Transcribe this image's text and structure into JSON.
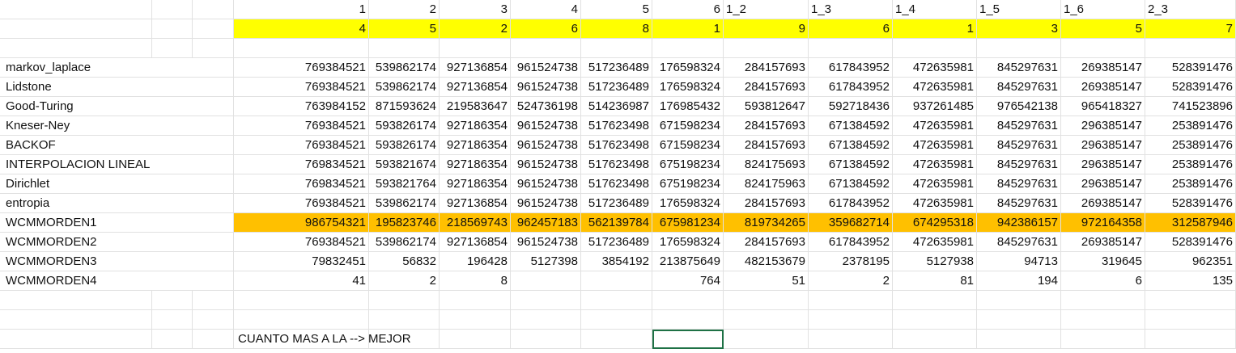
{
  "headers": [
    "1",
    "2",
    "3",
    "4",
    "5",
    "6",
    "1_2",
    "1_3",
    "1_4",
    "1_5",
    "1_6",
    "2_3"
  ],
  "ranks": [
    "4",
    "5",
    "2",
    "6",
    "8",
    "1",
    "9",
    "6",
    "1",
    "3",
    "5",
    "7"
  ],
  "rows": [
    {
      "label": "markov_laplace",
      "values": [
        "769384521",
        "539862174",
        "927136854",
        "961524738",
        "517236489",
        "176598324",
        "284157693",
        "617843952",
        "472635981",
        "845297631",
        "269385147",
        "528391476"
      ]
    },
    {
      "label": "Lidstone",
      "values": [
        "769384521",
        "539862174",
        "927136854",
        "961524738",
        "517236489",
        "176598324",
        "284157693",
        "617843952",
        "472635981",
        "845297631",
        "269385147",
        "528391476"
      ]
    },
    {
      "label": "Good-Turing",
      "values": [
        "763984152",
        "871593624",
        "219583647",
        "524736198",
        "514236987",
        "176985432",
        "593812647",
        "592718436",
        "937261485",
        "976542138",
        "965418327",
        "741523896"
      ]
    },
    {
      "label": "Kneser-Ney",
      "values": [
        "769384521",
        "593826174",
        "927186354",
        "961524738",
        "517623498",
        "671598234",
        "284157693",
        "671384592",
        "472635981",
        "845297631",
        "296385147",
        "253891476"
      ]
    },
    {
      "label": "BACKOF",
      "values": [
        "769384521",
        "593826174",
        "927186354",
        "961524738",
        "517623498",
        "671598234",
        "284157693",
        "671384592",
        "472635981",
        "845297631",
        "296385147",
        "253891476"
      ]
    },
    {
      "label": "INTERPOLACION LINEAL",
      "values": [
        "769834521",
        "593821674",
        "927186354",
        "961524738",
        "517623498",
        "675198234",
        "824175693",
        "671384592",
        "472635981",
        "845297631",
        "296385147",
        "253891476"
      ]
    },
    {
      "label": "Dirichlet",
      "values": [
        "769834521",
        "593821764",
        "927186354",
        "961524738",
        "517623498",
        "675198234",
        "824175963",
        "671384592",
        "472635981",
        "845297631",
        "296385147",
        "253891476"
      ]
    },
    {
      "label": "entropia",
      "values": [
        "769384521",
        "539862174",
        "927136854",
        "961524738",
        "517236489",
        "176598324",
        "284157693",
        "617843952",
        "472635981",
        "845297631",
        "269385147",
        "528391476"
      ]
    },
    {
      "label": "WCMMORDEN1",
      "values": [
        "986754321",
        "195823746",
        "218569743",
        "962457183",
        "562139784",
        "675981234",
        "819734265",
        "359682714",
        "674295318",
        "942386157",
        "972164358",
        "312587946"
      ],
      "highlight": true
    },
    {
      "label": "WCMMORDEN2",
      "values": [
        "769384521",
        "539862174",
        "927136854",
        "961524738",
        "517236489",
        "176598324",
        "284157693",
        "617843952",
        "472635981",
        "845297631",
        "269385147",
        "528391476"
      ]
    },
    {
      "label": "WCMMORDEN3",
      "values": [
        "79832451",
        "56832",
        "196428",
        "5127398",
        "3854192",
        "213875649",
        "482153679",
        "2378195",
        "5127938",
        "94713",
        "319645",
        "962351"
      ]
    },
    {
      "label": "WCMMORDEN4",
      "values": [
        "41",
        "2",
        "8",
        "",
        "",
        "764",
        "51",
        "2",
        "81",
        "194",
        "6",
        "135"
      ]
    }
  ],
  "note": "CUANTO MAS A LA --> MEJOR",
  "colors": {
    "header_highlight": "#ffff00",
    "row_highlight": "#ffc000",
    "selection": "#1e7145",
    "gridline": "#e1e1e1"
  }
}
